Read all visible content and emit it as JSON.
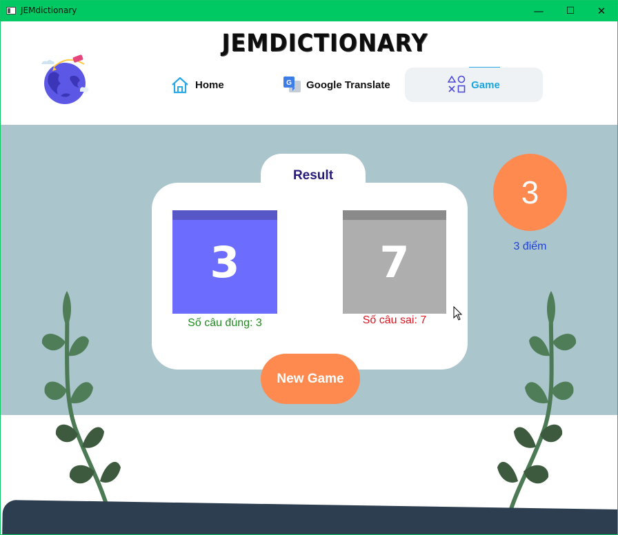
{
  "window": {
    "title": "JEMdictionary",
    "controls": {
      "minimize": "—",
      "maximize": "☐",
      "close": "✕"
    }
  },
  "header": {
    "app_name": "JEMDICTIONARY",
    "nav": [
      {
        "label": "Home",
        "icon": "home-icon",
        "active": false
      },
      {
        "label": "Google Translate",
        "icon": "google-translate-icon",
        "active": false
      },
      {
        "label": "Game",
        "icon": "game-shapes-icon",
        "active": true
      }
    ]
  },
  "result": {
    "title": "Result",
    "correct": {
      "value": "3",
      "caption": "Số câu đúng: 3",
      "color": "#6c6cff",
      "top_color": "#5757c8",
      "caption_color": "#1f8a1f"
    },
    "wrong": {
      "value": "7",
      "caption": "Số câu sai: 7",
      "color": "#aeaeae",
      "top_color": "#8a8a8a",
      "caption_color": "#e0141e"
    }
  },
  "score": {
    "value": "3",
    "caption": "3 điểm"
  },
  "actions": {
    "new_game": "New Game"
  },
  "colors": {
    "titlebar": "#00c863",
    "background": "#abc5cd",
    "accent": "#ff8a4f",
    "active_nav": "#1aa5e0",
    "ground": "#2d3e50",
    "leaf": "#4e7d57"
  }
}
